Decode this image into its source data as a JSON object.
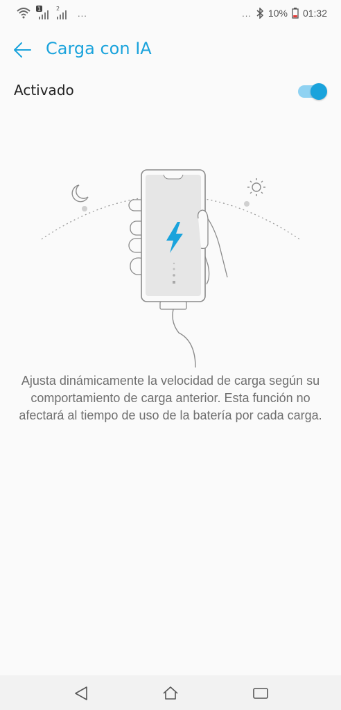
{
  "status_bar": {
    "sim1_badge": "1",
    "sim2_badge": "2",
    "left_overflow": "...",
    "right_overflow": "...",
    "battery_percent": "10%",
    "time": "01:32",
    "icons": [
      "wifi-icon",
      "signal-sim1-icon",
      "signal-sim2-icon",
      "bluetooth-icon",
      "battery-low-icon"
    ]
  },
  "app_bar": {
    "title": "Carga con IA",
    "back_icon": "arrow-left-icon"
  },
  "setting": {
    "label": "Activado",
    "enabled": true
  },
  "illustration": {
    "icons": [
      "moon-icon",
      "sun-icon",
      "phone-icon",
      "lightning-bolt-icon",
      "hand-icon",
      "charging-cable-icon"
    ]
  },
  "description": "Ajusta dinámicamente la velocidad de carga según su comportamiento de carga anterior. Esta función no afectará al tiempo de uso de la batería por cada carga.",
  "nav_bar": {
    "icons": [
      "back-triangle-icon",
      "home-icon",
      "recents-icon"
    ]
  },
  "colors": {
    "accent": "#1aa3dc",
    "toggle_track": "#8fd2f2",
    "background": "#fafafa",
    "text_secondary": "#6f6f6f"
  }
}
